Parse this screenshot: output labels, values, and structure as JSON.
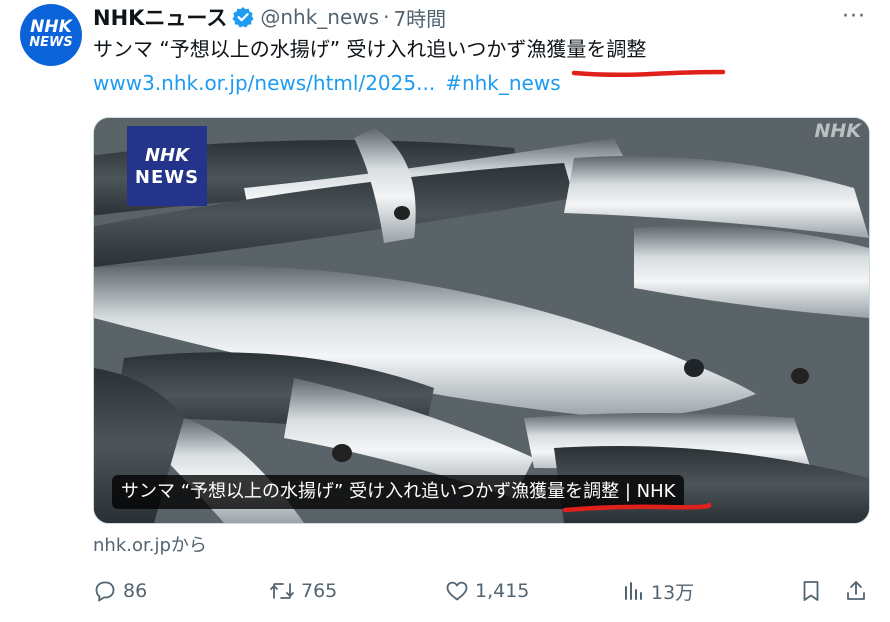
{
  "account": {
    "avatar_lines": [
      "NHK",
      "NEWS"
    ],
    "display_name": "NHKニュース",
    "handle": "@nhk_news",
    "separator": "·",
    "time": "7時間",
    "more": "···"
  },
  "tweet": {
    "text_prefix": "サンマ “予想以上の水揚げ” 受け入れ追いつかず",
    "text_highlight": "漁獲量を調整",
    "link": "www3.nhk.or.jp/news/html/2025...",
    "hashtag": "#nhk_news"
  },
  "media": {
    "badge_lines": [
      "NHK",
      "NEWS"
    ],
    "watermark": "NHK",
    "caption_prefix": "サンマ “予想以上の水揚げ” 受け入れ追いつかず",
    "caption_highlight": "漁獲量を調整",
    "caption_suffix": " | NHK",
    "source": "nhk.or.jpから"
  },
  "actions": {
    "reply_count": "86",
    "retweet_count": "765",
    "like_count": "1,415",
    "views_count": "13万"
  },
  "colors": {
    "link": "#1d9bf0",
    "muted": "#536471",
    "verified": "#1d9bf0",
    "avatar_bg": "#0a63d8",
    "badge_bg": "#23348a",
    "annotation_red": "#e0201b"
  },
  "icons": {
    "verified": "verified-badge-icon",
    "reply": "reply-icon",
    "retweet": "retweet-icon",
    "like": "heart-icon",
    "views": "views-chart-icon",
    "bookmark": "bookmark-icon",
    "share": "share-icon"
  }
}
